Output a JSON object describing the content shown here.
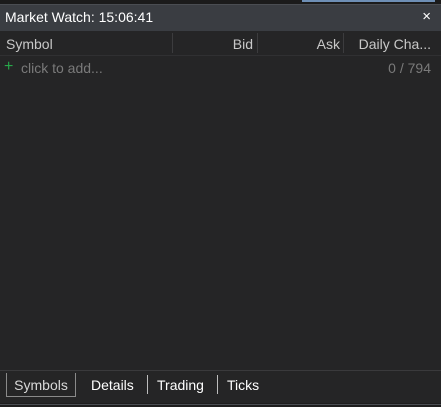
{
  "window": {
    "title": "Market Watch: 15:06:41",
    "close_glyph": "×"
  },
  "columns": {
    "symbol": "Symbol",
    "bid": "Bid",
    "ask": "Ask",
    "daily_change": "Daily Cha..."
  },
  "add_row": {
    "plus_glyph": "+",
    "placeholder": "click to add...",
    "count": "0 / 794"
  },
  "tabs": [
    {
      "label": "Symbols",
      "active": true
    },
    {
      "label": "Details",
      "active": false
    },
    {
      "label": "Trading",
      "active": false
    },
    {
      "label": "Ticks",
      "active": false
    }
  ],
  "colors": {
    "title_bg": "#3a3d42",
    "panel_bg": "#252526",
    "add_plus": "#27a84a",
    "muted_text": "#7a7a7a"
  },
  "icons": {
    "close": "close-icon",
    "add": "plus-icon"
  }
}
